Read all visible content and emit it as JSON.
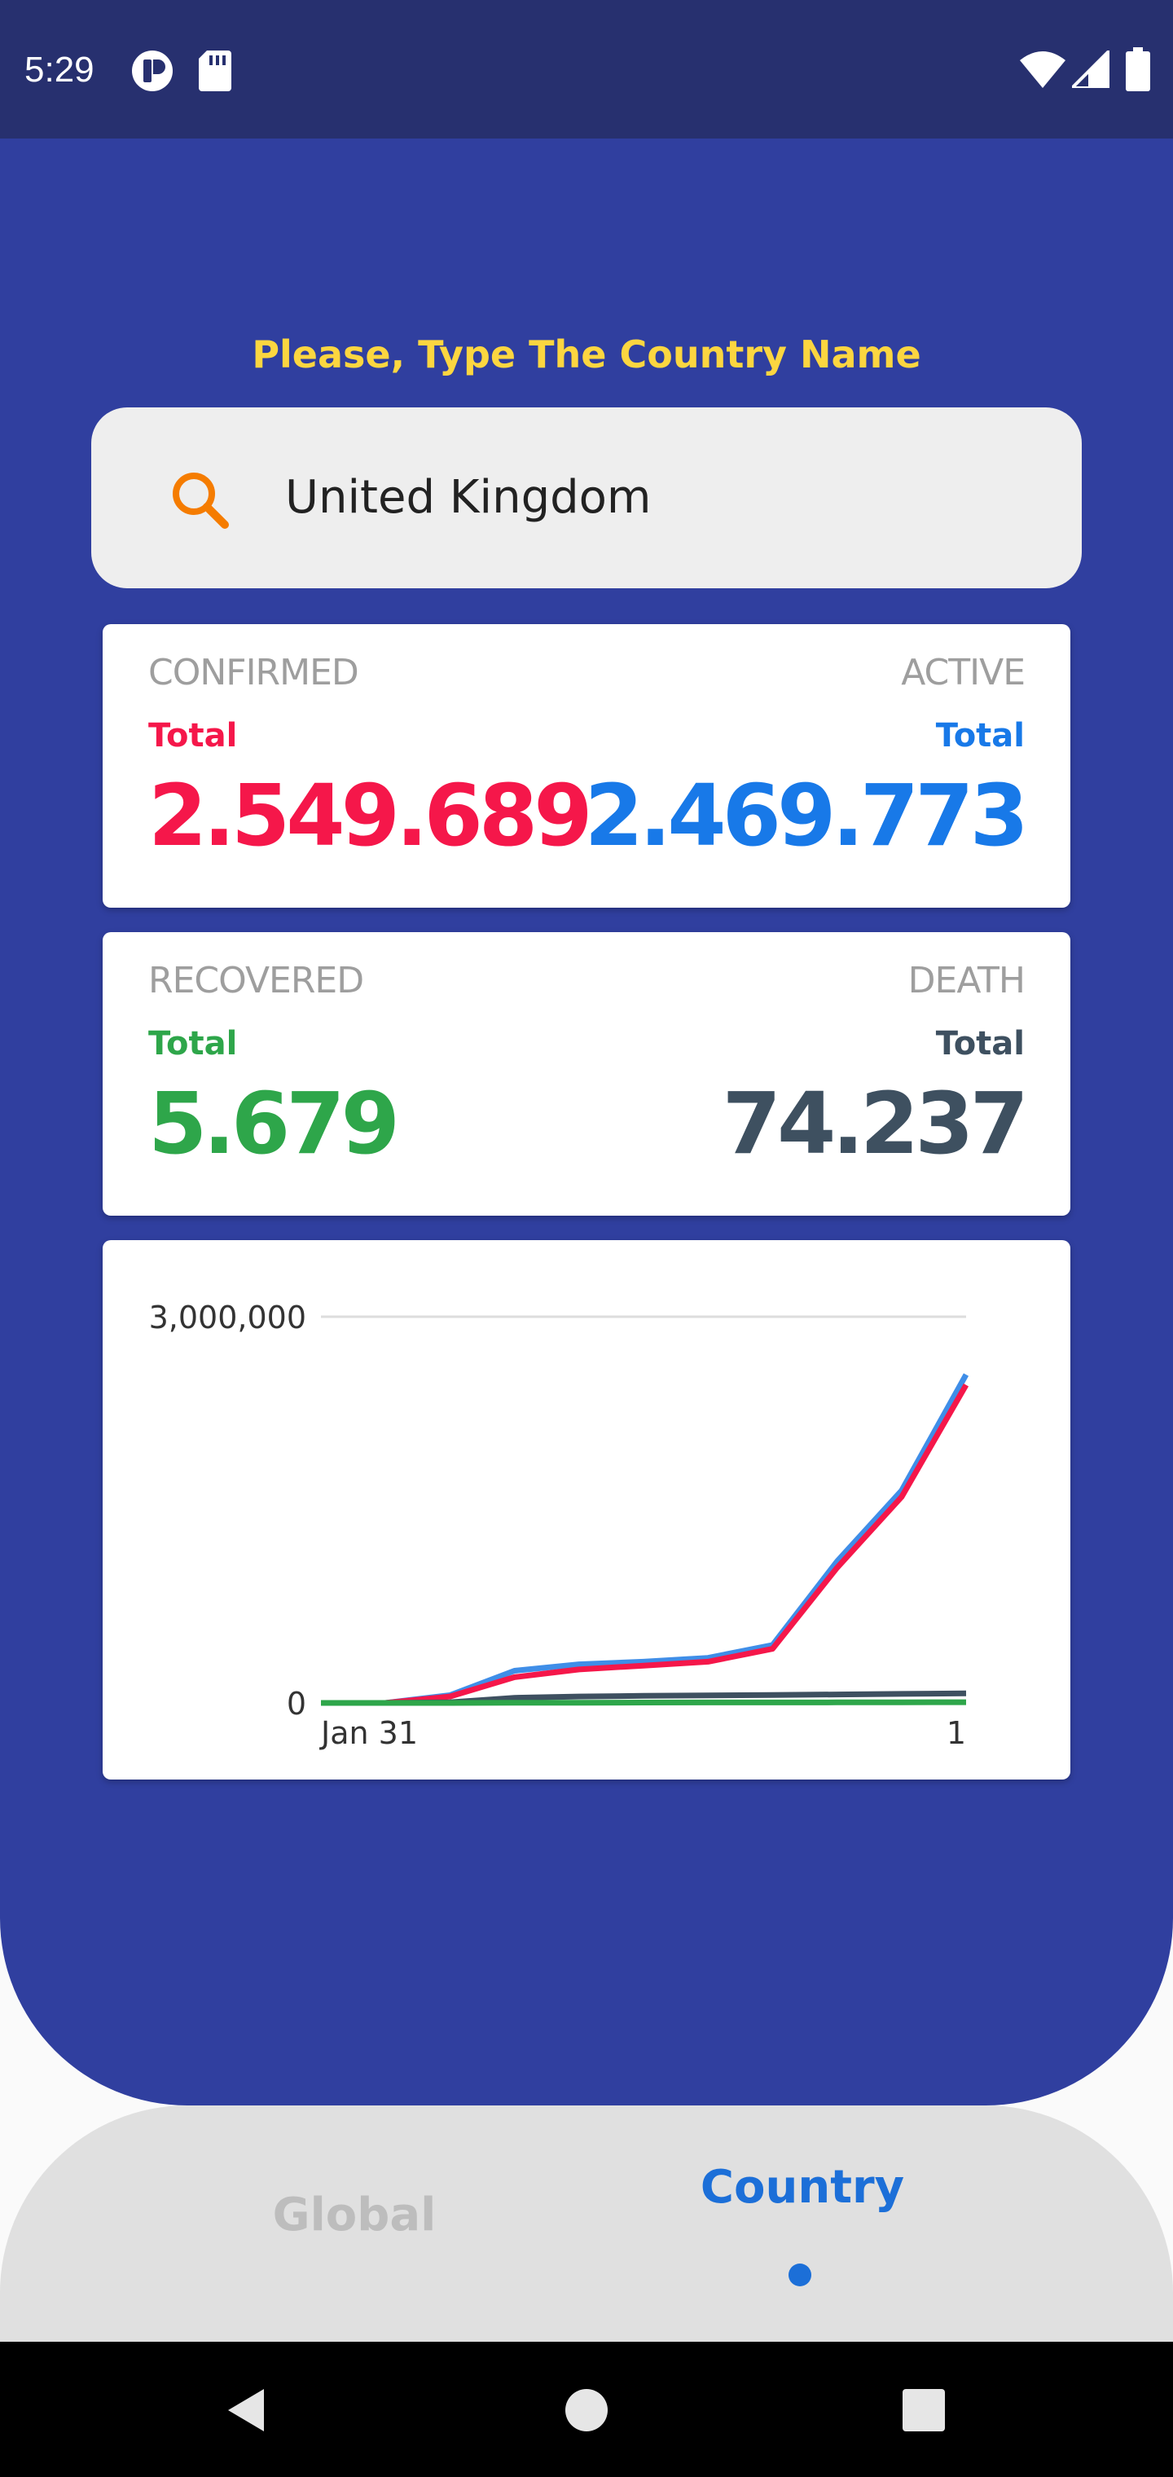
{
  "status_bar": {
    "time": "5:29",
    "left_icons": [
      "app-notification-icon",
      "sd-card-icon"
    ],
    "right_icons": [
      "wifi-icon",
      "cellular-signal-icon",
      "battery-icon"
    ]
  },
  "search": {
    "prompt": "Please, Type The Country Name",
    "value": "United Kingdom",
    "icon": "search-icon"
  },
  "stats": {
    "confirmed": {
      "label": "CONFIRMED",
      "sub": "Total",
      "value": "2.549.689",
      "color": "#f5174a"
    },
    "active": {
      "label": "ACTIVE",
      "sub": "Total",
      "value": "2.469.773",
      "color": "#1879e8"
    },
    "recovered": {
      "label": "RECOVERED",
      "sub": "Total",
      "value": "5.679",
      "color": "#2ea64a"
    },
    "death": {
      "label": "DEATH",
      "sub": "Total",
      "value": "74.237",
      "color": "#3e5060"
    }
  },
  "chart_data": {
    "type": "line",
    "title": "",
    "xlabel": "",
    "ylabel": "",
    "ylim": [
      0,
      3000000
    ],
    "yticks": [
      "3,000,000",
      "0"
    ],
    "xticks": [
      "Jan 31",
      "1"
    ],
    "grid": true,
    "x_index": [
      0,
      10,
      20,
      30,
      40,
      50,
      60,
      70,
      80,
      90,
      100
    ],
    "series": [
      {
        "color": "#3f8ee8",
        "values": [
          0,
          0,
          60000,
          250000,
          300000,
          320000,
          350000,
          450000,
          1100000,
          1650000,
          2550000
        ]
      },
      {
        "color": "#f5174a",
        "values": [
          0,
          0,
          50000,
          200000,
          260000,
          290000,
          320000,
          420000,
          1050000,
          1600000,
          2470000
        ]
      },
      {
        "color": "#3e5060",
        "values": [
          0,
          0,
          5000,
          40000,
          50000,
          55000,
          58000,
          62000,
          66000,
          70000,
          74237
        ]
      },
      {
        "color": "#2ea64a",
        "values": [
          0,
          0,
          0,
          1000,
          2000,
          3000,
          3500,
          4000,
          4500,
          5000,
          5679
        ]
      }
    ]
  },
  "nav": {
    "global_label": "Global",
    "country_label": "Country",
    "active_color": "#1c6fd8"
  },
  "system_nav": [
    "back-icon",
    "home-icon",
    "recents-icon"
  ]
}
